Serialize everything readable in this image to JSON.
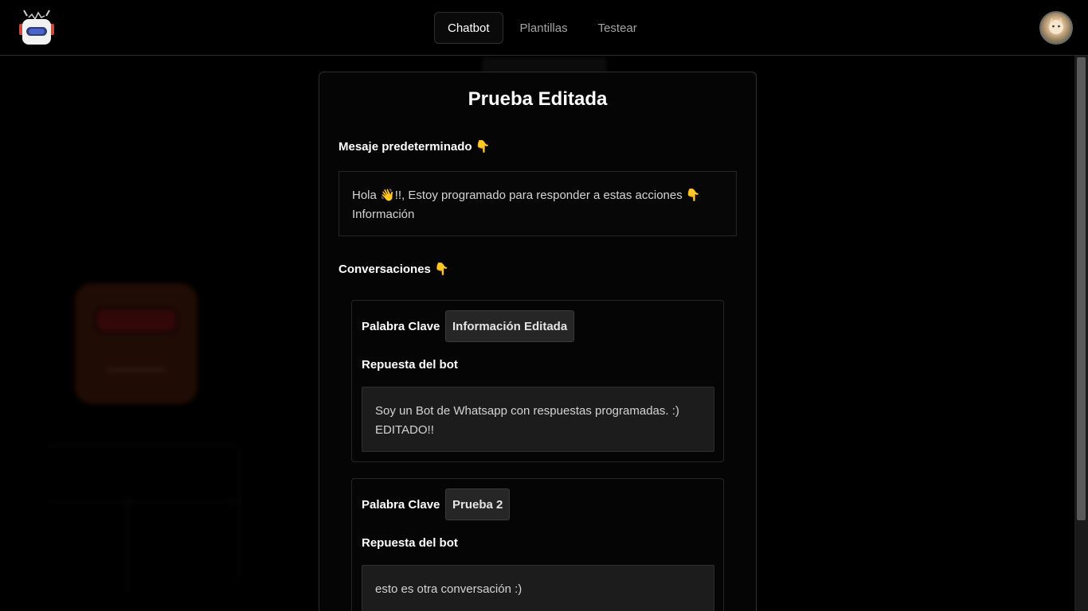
{
  "header": {
    "logo_icon": "robot-logo-icon",
    "nav": [
      {
        "label": "Chatbot",
        "active": true
      },
      {
        "label": "Plantillas",
        "active": false
      },
      {
        "label": "Testear",
        "active": false
      }
    ],
    "avatar_icon": "user-avatar"
  },
  "card": {
    "title": "Prueba Editada",
    "default_message_label": "Mesaje predeterminado",
    "default_message_emoji": "👇",
    "default_message_line1": "Hola 👋!!, Estoy programado para responder a estas acciones 👇",
    "default_message_line2": "Información",
    "conversations_label": "Conversaciones",
    "conversations_emoji": "👇",
    "conversations": [
      {
        "keyword_label": "Palabra Clave",
        "keyword": "Información Editada",
        "response_label": "Repuesta del bot",
        "response_line1": "Soy un Bot de Whatsapp con respuestas programadas. :)",
        "response_line2": "EDITADO!!"
      },
      {
        "keyword_label": "Palabra Clave",
        "keyword": "Prueba 2",
        "response_label": "Repuesta del bot",
        "response_line1": "esto es otra conversación :)",
        "response_line2": ""
      }
    ]
  },
  "colors": {
    "background": "#000000",
    "card_border": "#2e2e2e",
    "keyword_bg": "#262626",
    "response_bg": "#1c1c1c",
    "emoji": "#f5b82a"
  }
}
